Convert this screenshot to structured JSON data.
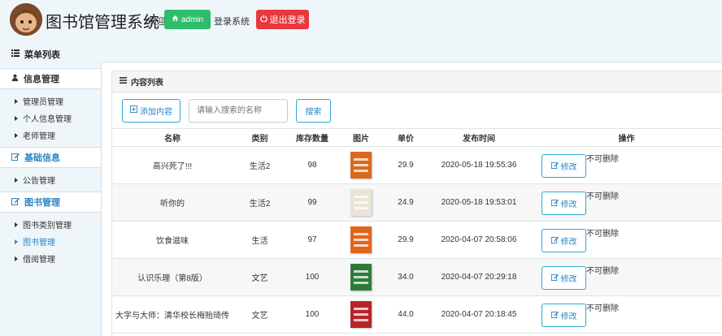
{
  "header": {
    "app_title": "图书馆管理系统",
    "welcome": "欢迎",
    "admin_label": "admin",
    "logged_text": "登录系统",
    "logout_label": "退出登录",
    "admin_color": "#2ebd6b",
    "logout_color": "#e8383d"
  },
  "sidebar": {
    "menu_title": "菜单列表",
    "sections": [
      {
        "title": "信息管理",
        "icon": "user-icon",
        "items": [
          "管理员管理",
          "个人信息管理",
          "老师管理"
        ]
      },
      {
        "title": "基础信息",
        "icon": "edit-icon",
        "items": [
          "公告管理"
        ]
      },
      {
        "title": "图书管理",
        "icon": "edit-icon",
        "items": [
          "图书类别管理",
          "图书管理",
          "借阅管理"
        ],
        "active_item": "图书管理"
      }
    ]
  },
  "main": {
    "panel_title": "内容列表",
    "add_label": "添加内容",
    "search_placeholder": "请输入搜索的名称",
    "search_label": "搜索",
    "columns": [
      "名称",
      "类别",
      "库存数量",
      "图片",
      "单价",
      "发布时间",
      "操作"
    ],
    "edit_label": "修改",
    "no_delete_label": "不可删除",
    "rows": [
      {
        "name": "高兴死了!!!",
        "category": "生活2",
        "stock": "98",
        "price": "29.9",
        "time": "2020-05-18 19:55:36",
        "cover_color": "#d9691f"
      },
      {
        "name": "听你的",
        "category": "生活2",
        "stock": "99",
        "price": "24.9",
        "time": "2020-05-18 19:53:01",
        "cover_color": "#e9e4d6"
      },
      {
        "name": "饮食滋味",
        "category": "生活",
        "stock": "97",
        "price": "29.9",
        "time": "2020-04-07 20:58:06",
        "cover_color": "#e0661f"
      },
      {
        "name": "认识乐理（第8版）",
        "category": "文艺",
        "stock": "100",
        "price": "34.0",
        "time": "2020-04-07 20:29:18",
        "cover_color": "#2f7a3a"
      },
      {
        "name": "大字与大师：清华校长梅贻琦传",
        "category": "文艺",
        "stock": "100",
        "price": "44.0",
        "time": "2020-04-07 20:18:45",
        "cover_color": "#b8232a"
      }
    ]
  }
}
